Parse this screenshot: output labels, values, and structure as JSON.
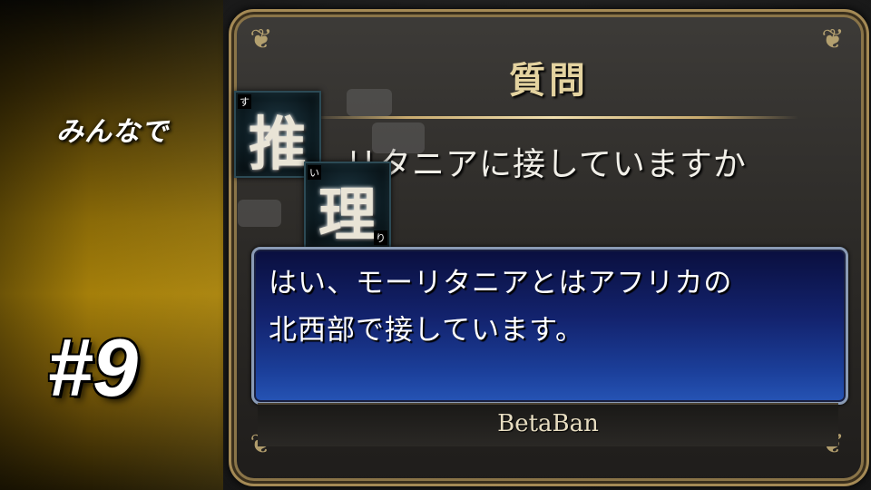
{
  "logo": {
    "prefix": "みんなで",
    "tile1": {
      "kanji": "推",
      "furigana": "す"
    },
    "tile2": {
      "kanji": "理",
      "furigana_a": "い",
      "furigana_b": "り"
    }
  },
  "episode": {
    "number": "#9"
  },
  "panel": {
    "title": "質問",
    "question": "リタニアに接していますか",
    "answer_line1": "はい、モーリタニアとはアフリカの",
    "answer_line2": "北西部で接しています。",
    "player": "BetaBan"
  },
  "colors": {
    "gold_accent": "#a57f0a",
    "frame_border": "#a58a55",
    "answer_box_top": "#0a0f3e",
    "answer_box_bottom": "#2654b5",
    "title_text": "#e4d3a0"
  }
}
